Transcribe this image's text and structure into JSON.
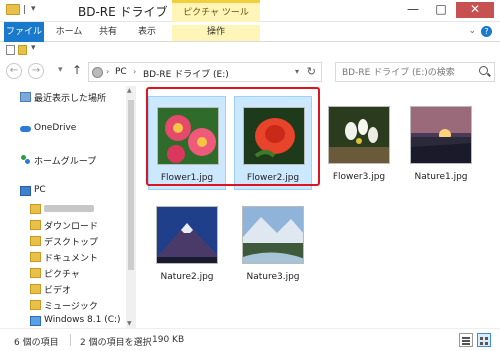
{
  "window": {
    "title": "BD-RE ドライブ (E:)",
    "context_tab_group": "ピクチャ ツール",
    "minimize": "—",
    "maximize": "□",
    "close": "✕"
  },
  "ribbon": {
    "tabs": [
      {
        "label": "ファイル",
        "active": true
      },
      {
        "label": "ホーム"
      },
      {
        "label": "共有"
      },
      {
        "label": "表示"
      },
      {
        "label": "操作",
        "contextual": true
      }
    ]
  },
  "navigation": {
    "back": "←",
    "forward": "→",
    "recent_dropdown": "▾",
    "up": "↑",
    "breadcrumb": [
      "PC",
      "BD-RE ドライブ (E:)"
    ],
    "breadcrumb_separator": "›",
    "address_dropdown": "▾",
    "refresh": "↻"
  },
  "search": {
    "placeholder": "BD-RE ドライブ (E:)の検索"
  },
  "sidebar": {
    "items": [
      {
        "label": "最近表示した場所",
        "icon": "recent-places-icon"
      },
      {
        "label": "OneDrive",
        "icon": "onedrive-icon"
      },
      {
        "label": "ホームグループ",
        "icon": "homegroup-icon"
      },
      {
        "label": "PC",
        "icon": "pc-icon"
      },
      {
        "label": "",
        "icon": "user-folder-icon",
        "redacted": true
      },
      {
        "label": "ダウンロード",
        "icon": "folder-icon"
      },
      {
        "label": "デスクトップ",
        "icon": "folder-icon"
      },
      {
        "label": "ドキュメント",
        "icon": "folder-icon"
      },
      {
        "label": "ピクチャ",
        "icon": "folder-icon"
      },
      {
        "label": "ビデオ",
        "icon": "folder-icon"
      },
      {
        "label": "ミュージック",
        "icon": "folder-icon"
      },
      {
        "label": "Windows 8.1 (C:)",
        "icon": "windows-drive-icon"
      }
    ]
  },
  "files": [
    {
      "name": "Flower1.jpg",
      "selected": true
    },
    {
      "name": "Flower2.jpg",
      "selected": true
    },
    {
      "name": "Flower3.jpg",
      "selected": false
    },
    {
      "name": "Nature1.jpg",
      "selected": false
    },
    {
      "name": "Nature2.jpg",
      "selected": false
    },
    {
      "name": "Nature3.jpg",
      "selected": false
    }
  ],
  "status": {
    "item_count": "6 個の項目",
    "selection": "2 個の項目を選択",
    "size": "190 KB"
  },
  "colors": {
    "accent": "#1979ca",
    "selection_fill": "#cce8ff",
    "selection_border": "#99d1ff",
    "highlight_frame": "#e0141e",
    "context_tab": "#fff5b8"
  }
}
